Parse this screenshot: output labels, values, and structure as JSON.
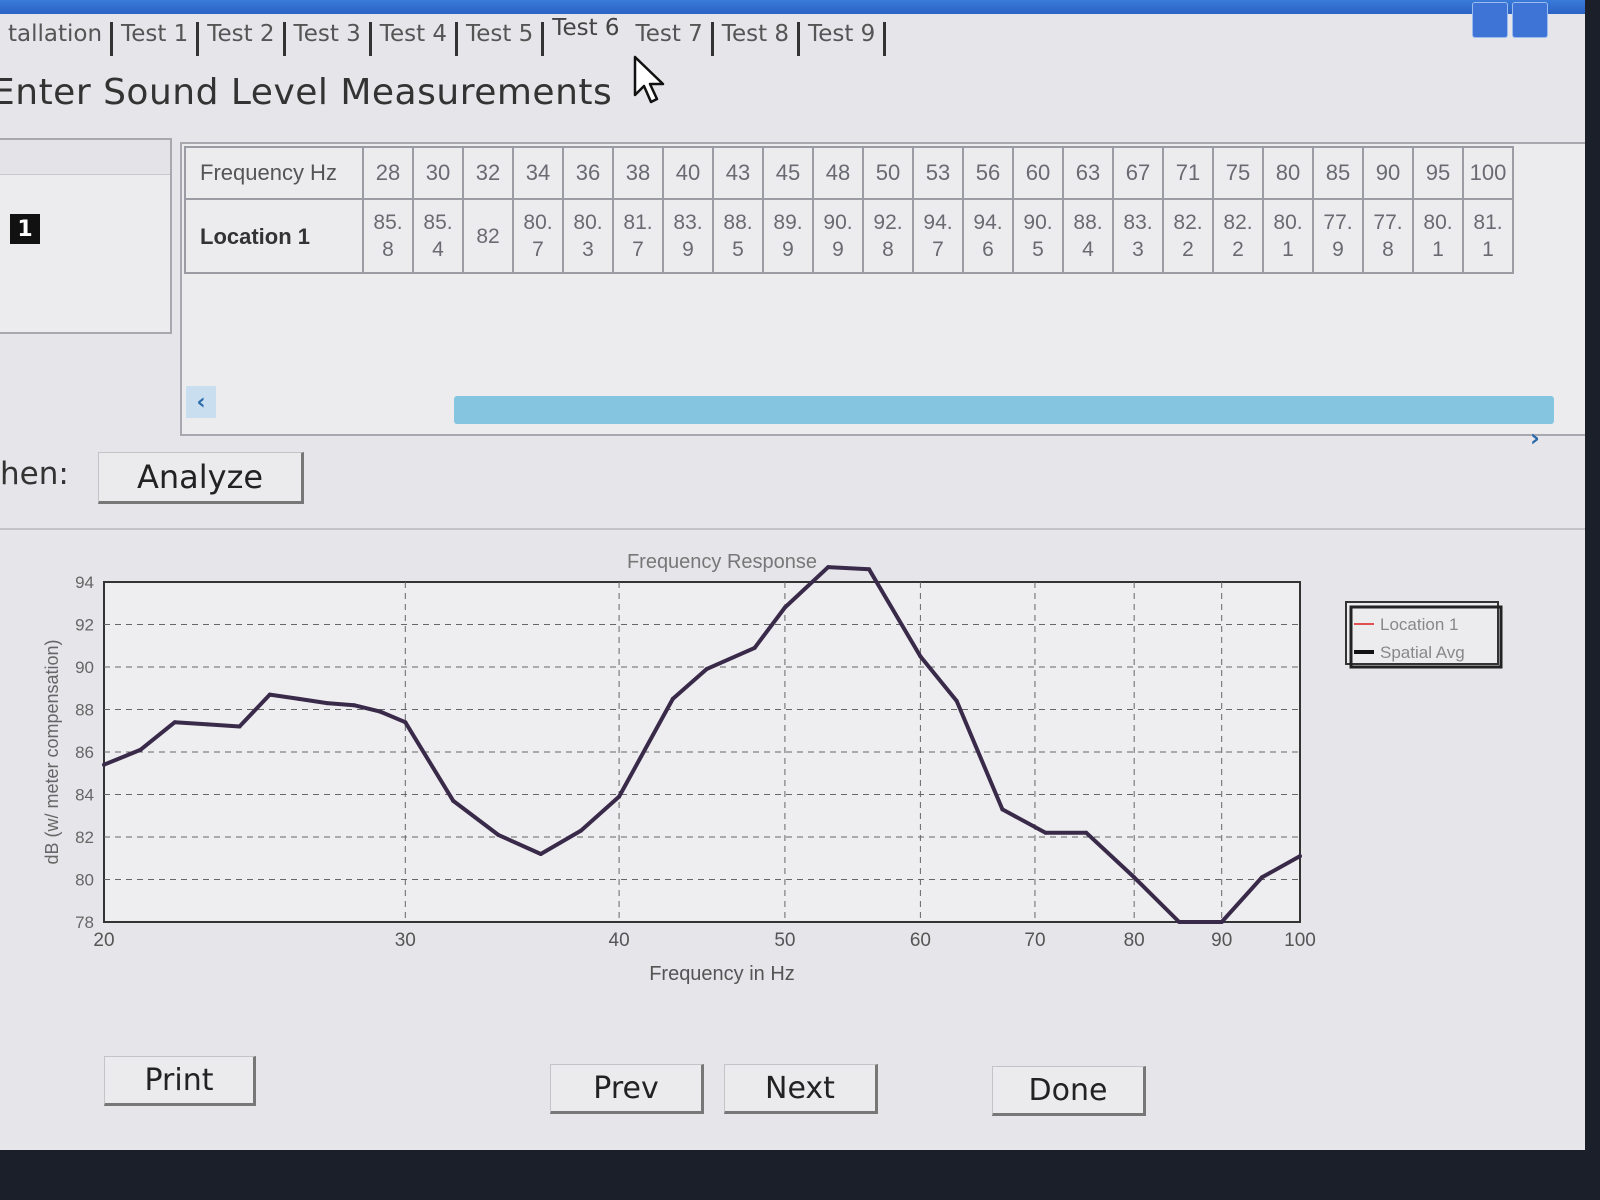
{
  "tabs": {
    "items": [
      "tallation",
      "Test 1",
      "Test 2",
      "Test 3",
      "Test 4",
      "Test 5",
      "Test 6",
      "Test 7",
      "Test 8",
      "Test 9"
    ],
    "active": "Test 6"
  },
  "heading": "Enter Sound Level Measurements",
  "location_badge": "1",
  "table": {
    "header_label": "Frequency Hz",
    "frequencies": [
      "28",
      "30",
      "32",
      "34",
      "36",
      "38",
      "40",
      "43",
      "45",
      "48",
      "50",
      "53",
      "56",
      "60",
      "63",
      "67",
      "71",
      "75",
      "80",
      "85",
      "90",
      "95",
      "100"
    ],
    "row_label": "Location 1",
    "values": [
      [
        "85.",
        "8"
      ],
      [
        "85.",
        "4"
      ],
      [
        "82",
        ""
      ],
      [
        "80.",
        "7"
      ],
      [
        "80.",
        "3"
      ],
      [
        "81.",
        "7"
      ],
      [
        "83.",
        "9"
      ],
      [
        "88.",
        "5"
      ],
      [
        "89.",
        "9"
      ],
      [
        "90.",
        "9"
      ],
      [
        "92.",
        "8"
      ],
      [
        "94.",
        "7"
      ],
      [
        "94.",
        "6"
      ],
      [
        "90.",
        "5"
      ],
      [
        "88.",
        "4"
      ],
      [
        "83.",
        "3"
      ],
      [
        "82.",
        "2"
      ],
      [
        "82.",
        "2"
      ],
      [
        "80.",
        "1"
      ],
      [
        "77.",
        "9"
      ],
      [
        "77.",
        "8"
      ],
      [
        "80.",
        "1"
      ],
      [
        "81.",
        "1"
      ]
    ]
  },
  "then_label": "hen:",
  "buttons": {
    "analyze": "Analyze",
    "print": "Print",
    "prev": "Prev",
    "next": "Next",
    "done": "Done"
  },
  "chart_data": {
    "type": "line",
    "title": "Frequency Response",
    "xlabel": "Frequency in Hz",
    "ylabel": "dB (w/ meter compensation)",
    "x_scale": "log",
    "xlim": [
      20,
      100
    ],
    "ylim": [
      78,
      94
    ],
    "x_ticks": [
      20,
      30,
      40,
      50,
      60,
      70,
      80,
      90,
      100
    ],
    "y_ticks": [
      78,
      80,
      82,
      84,
      86,
      88,
      90,
      92,
      94
    ],
    "grid": true,
    "legend_position": "right",
    "line_color": "#3a2a4a",
    "series": [
      {
        "name": "Location 1",
        "color": "#e05050"
      },
      {
        "name": "Spatial Avg",
        "color": "#111111",
        "x": [
          20,
          21,
          22,
          23,
          24,
          25,
          26,
          27,
          28,
          29,
          30,
          32,
          34,
          36,
          38,
          40,
          43,
          45,
          48,
          50,
          53,
          56,
          60,
          63,
          67,
          71,
          75,
          80,
          85,
          90,
          95,
          100
        ],
        "y": [
          85.4,
          86.1,
          87.4,
          87.3,
          87.2,
          88.7,
          88.5,
          88.3,
          88.2,
          87.9,
          87.4,
          83.7,
          82.1,
          81.2,
          82.3,
          83.9,
          88.5,
          89.9,
          90.9,
          92.8,
          94.7,
          94.6,
          90.5,
          88.4,
          83.3,
          82.2,
          82.2,
          80.1,
          78.0,
          78.0,
          80.1,
          81.1
        ]
      }
    ]
  }
}
